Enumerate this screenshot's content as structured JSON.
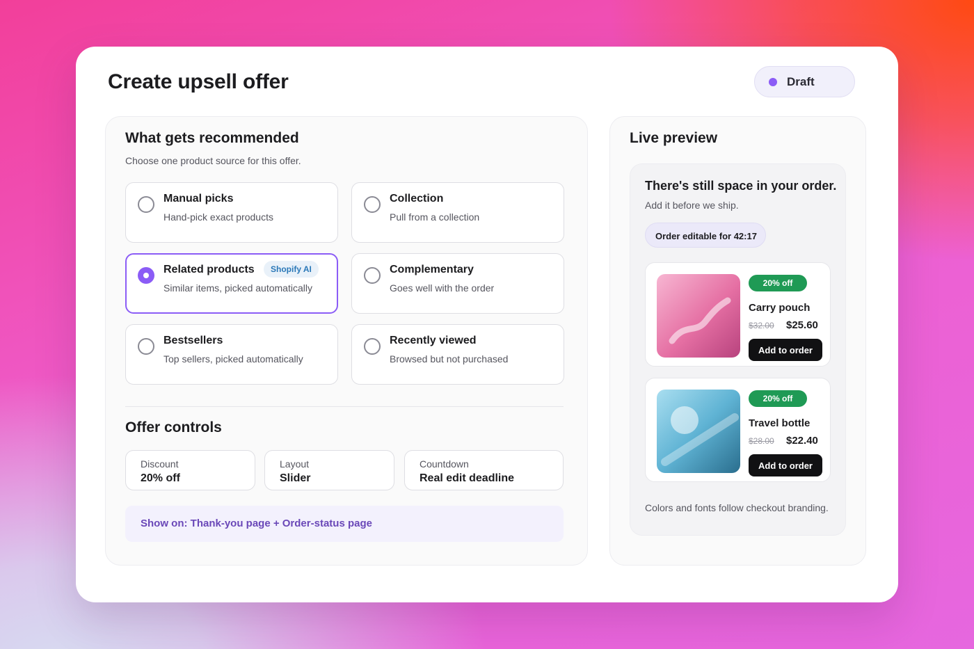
{
  "header": {
    "title": "Create upsell offer",
    "status": {
      "label": "Draft",
      "dot_color": "#8b5cf6"
    }
  },
  "recommend": {
    "title": "What gets recommended",
    "subtitle": "Choose one product source for this offer.",
    "options": [
      {
        "title": "Manual picks",
        "desc": "Hand-pick exact products",
        "selected": false
      },
      {
        "title": "Collection",
        "desc": "Pull from a collection",
        "selected": false
      },
      {
        "title": "Related products",
        "desc": "Similar items, picked automatically",
        "badge": "Shopify AI",
        "selected": true
      },
      {
        "title": "Complementary",
        "desc": "Goes well with the order",
        "selected": false
      },
      {
        "title": "Bestsellers",
        "desc": "Top sellers, picked automatically",
        "selected": false
      },
      {
        "title": "Recently viewed",
        "desc": "Browsed but not purchased",
        "selected": false
      }
    ]
  },
  "controls": {
    "title": "Offer controls",
    "items": [
      {
        "label": "Discount",
        "value": "20% off"
      },
      {
        "label": "Layout",
        "value": "Slider"
      },
      {
        "label": "Countdown",
        "value": "Real edit deadline"
      }
    ],
    "show_on": "Show on: Thank-you page + Order-status page"
  },
  "preview": {
    "title": "Live preview",
    "headline": "There's still space in your order.",
    "subline": "Add it before we ship.",
    "timer": "Order editable for 42:17",
    "products": [
      {
        "badge": "20% off",
        "name": "Carry pouch",
        "old_price": "$32.00",
        "new_price": "$25.60",
        "button": "Add to order",
        "thumb_icon": "pouch-image"
      },
      {
        "badge": "20% off",
        "name": "Travel bottle",
        "old_price": "$28.00",
        "new_price": "$22.40",
        "button": "Add to order",
        "thumb_icon": "bottle-image"
      }
    ],
    "footer": "Colors and fonts follow checkout branding."
  },
  "colors": {
    "accent": "#8b5cf6",
    "discount_badge": "#1f9a55",
    "button_dark": "#111113"
  }
}
